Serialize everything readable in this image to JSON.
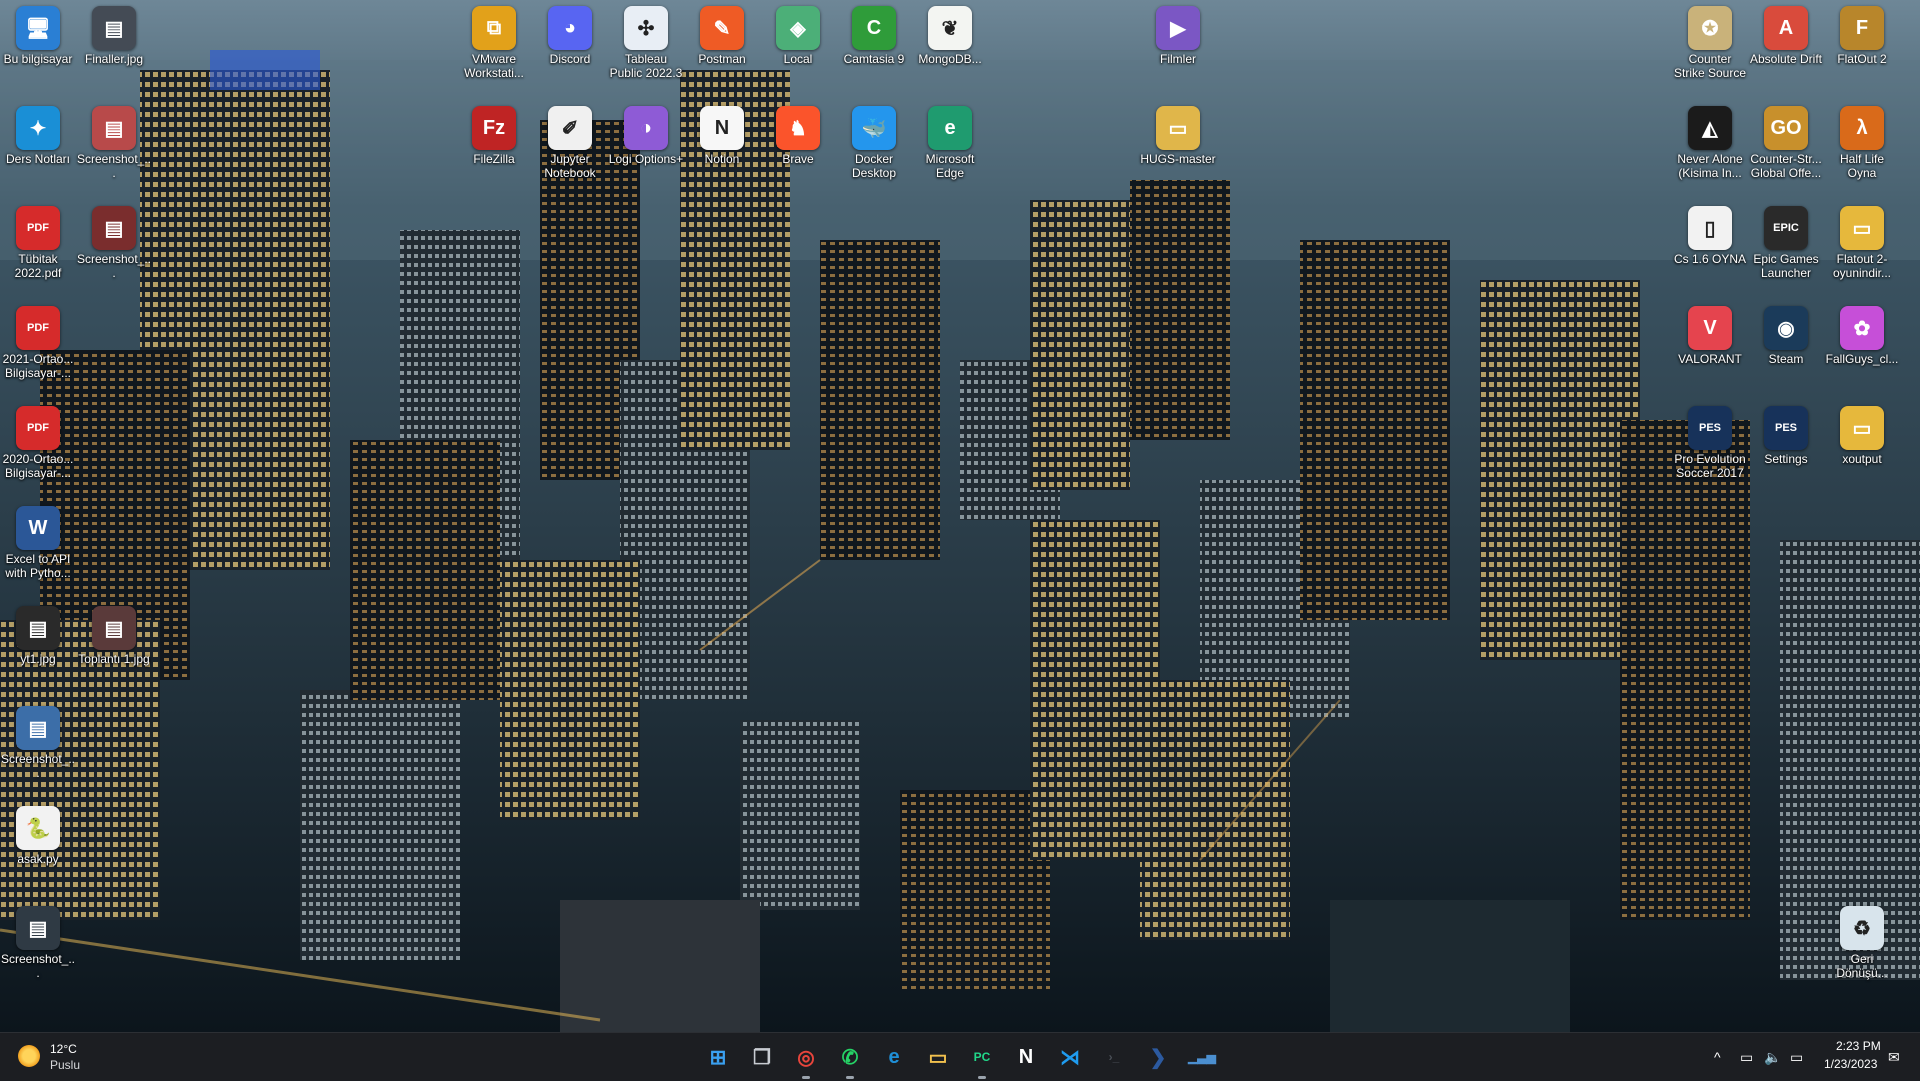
{
  "desktop": {
    "icons": [
      {
        "label": "Bu bilgisayar",
        "glyph": "🖥",
        "color": "#2a7fd4",
        "icon": "computer-icon"
      },
      {
        "label": "Finaller.jpg",
        "glyph": "▤",
        "color": "#444b55",
        "icon": "image-file-icon"
      },
      {
        "label": "VMware Workstati...",
        "glyph": "⧉",
        "color": "#e2a11a",
        "icon": "vmware-icon"
      },
      {
        "label": "Discord",
        "glyph": "◕",
        "color": "#5865f2",
        "icon": "discord-icon"
      },
      {
        "label": "Tableau Public 2022.3",
        "glyph": "✣",
        "color": "#e8eef5",
        "icon": "tableau-icon"
      },
      {
        "label": "Postman",
        "glyph": "✎",
        "color": "#ef5b25",
        "icon": "postman-icon"
      },
      {
        "label": "Local",
        "glyph": "◈",
        "color": "#4caf78",
        "icon": "local-icon"
      },
      {
        "label": "Camtasia 9",
        "glyph": "C",
        "color": "#2f9c3a",
        "icon": "camtasia-icon"
      },
      {
        "label": "MongoDB...",
        "glyph": "❦",
        "color": "#f3f5f2",
        "icon": "mongodb-icon"
      },
      {
        "label": "Filmler",
        "glyph": "▶",
        "color": "#7b57c4",
        "icon": "folder-videos-icon"
      },
      {
        "label": "Counter Strike Source",
        "glyph": "✪",
        "color": "#c9b27a",
        "icon": "css-icon"
      },
      {
        "label": "Absolute Drift",
        "glyph": "A",
        "color": "#d94b3c",
        "icon": "absolute-drift-icon"
      },
      {
        "label": "FlatOut 2",
        "glyph": "F",
        "color": "#b8862b",
        "icon": "flatout-icon"
      },
      {
        "label": "Ders Notları",
        "glyph": "✦",
        "color": "#1a8fd6",
        "icon": "accessibility-icon"
      },
      {
        "label": "Screenshot_...",
        "glyph": "▤",
        "color": "#b84a4a",
        "icon": "image-file-icon"
      },
      {
        "label": "FileZilla",
        "glyph": "Fz",
        "color": "#bf2424",
        "icon": "filezilla-icon"
      },
      {
        "label": "Jupyter Notebook",
        "glyph": "✐",
        "color": "#f0f0f0",
        "icon": "jupyter-icon"
      },
      {
        "label": "Logi Options+",
        "glyph": "◑",
        "color": "#8e5bd6",
        "icon": "logi-icon"
      },
      {
        "label": "Notion",
        "glyph": "N",
        "color": "#f7f7f7",
        "icon": "notion-icon"
      },
      {
        "label": "Brave",
        "glyph": "♞",
        "color": "#fb542b",
        "icon": "brave-icon"
      },
      {
        "label": "Docker Desktop",
        "glyph": "🐳",
        "color": "#2496ed",
        "icon": "docker-icon"
      },
      {
        "label": "Microsoft Edge",
        "glyph": "e",
        "color": "#1f9b6f",
        "icon": "edge-icon"
      },
      {
        "label": "HUGS-master",
        "glyph": "▭",
        "color": "#e0b64a",
        "icon": "folder-icon"
      },
      {
        "label": "Never Alone (Kisima In...",
        "glyph": "◭",
        "color": "#1b1b1b",
        "icon": "never-alone-icon"
      },
      {
        "label": "Counter-Str... Global Offe...",
        "glyph": "GO",
        "color": "#c8902c",
        "icon": "csgo-icon"
      },
      {
        "label": "Half Life Oyna",
        "glyph": "λ",
        "color": "#d96a1a",
        "icon": "half-life-icon"
      },
      {
        "label": "Tübitak 2022.pdf",
        "glyph": "PDF",
        "color": "#d62b2b",
        "icon": "pdf-icon"
      },
      {
        "label": "Screenshot_...",
        "glyph": "▤",
        "color": "#7a2d2d",
        "icon": "image-file-icon"
      },
      {
        "label": "Cs 1.6 OYNA",
        "glyph": "▯",
        "color": "#f2f2f2",
        "icon": "document-icon"
      },
      {
        "label": "Epic Games Launcher",
        "glyph": "EPIC",
        "color": "#2a2a2a",
        "icon": "epic-games-icon"
      },
      {
        "label": "Flatout 2-oyunindir...",
        "glyph": "▭",
        "color": "#e6b83c",
        "icon": "folder-icon"
      },
      {
        "label": "2021-Ortao... Bilgisayar-...",
        "glyph": "PDF",
        "color": "#d62b2b",
        "icon": "pdf-icon"
      },
      {
        "label": "VALORANT",
        "glyph": "V",
        "color": "#e5444e",
        "icon": "valorant-icon"
      },
      {
        "label": "Steam",
        "glyph": "◉",
        "color": "#1b3b5a",
        "icon": "steam-icon"
      },
      {
        "label": "FallGuys_cl...",
        "glyph": "✿",
        "color": "#c64fd8",
        "icon": "fallguys-icon"
      },
      {
        "label": "2020-Ortao... Bilgisayar-...",
        "glyph": "PDF",
        "color": "#d62b2b",
        "icon": "pdf-icon"
      },
      {
        "label": "Pro Evolution Soccer 2017",
        "glyph": "PES",
        "color": "#17325a",
        "icon": "pes-icon"
      },
      {
        "label": "Settings",
        "glyph": "PES",
        "color": "#17325a",
        "icon": "pes-settings-icon"
      },
      {
        "label": "xoutput",
        "glyph": "▭",
        "color": "#e6b83c",
        "icon": "folder-icon"
      },
      {
        "label": "Excel to API with Pytho...",
        "glyph": "W",
        "color": "#2b5797",
        "icon": "word-file-icon"
      },
      {
        "label": "yt1.jpg",
        "glyph": "▤",
        "color": "#2a2a2a",
        "icon": "image-file-icon"
      },
      {
        "label": "Toplantı 1.jpg",
        "glyph": "▤",
        "color": "#5a3a3a",
        "icon": "image-file-icon"
      },
      {
        "label": "Screenshot_...",
        "glyph": "▤",
        "color": "#3c6ea8",
        "icon": "image-file-icon"
      },
      {
        "label": "asak.py",
        "glyph": "🐍",
        "color": "#f2f2f2",
        "icon": "python-file-icon"
      },
      {
        "label": "Screenshot_...",
        "glyph": "▤",
        "color": "#2f3a44",
        "icon": "image-file-icon"
      },
      {
        "label": "Geri Dönüşü...",
        "glyph": "♻",
        "color": "#d8e4ec",
        "icon": "recycle-bin-icon"
      }
    ]
  },
  "taskbar": {
    "weather": {
      "temp": "12°C",
      "condition": "Puslu"
    },
    "apps": [
      {
        "name": "start",
        "glyph": "⊞",
        "color": "#3aa0f0",
        "icon": "windows-start-icon",
        "active": false
      },
      {
        "name": "task-view",
        "glyph": "❐",
        "color": "#c8ccd2",
        "icon": "task-view-icon",
        "active": false
      },
      {
        "name": "chrome",
        "glyph": "◎",
        "color": "#e8453c",
        "icon": "chrome-icon",
        "active": true
      },
      {
        "name": "whatsapp",
        "glyph": "✆",
        "color": "#25d366",
        "icon": "whatsapp-icon",
        "active": true
      },
      {
        "name": "edge",
        "glyph": "e",
        "color": "#1f8fd6",
        "icon": "edge-icon",
        "active": false
      },
      {
        "name": "file-explorer",
        "glyph": "▭",
        "color": "#f2c14e",
        "icon": "folder-icon",
        "active": false
      },
      {
        "name": "pycharm",
        "glyph": "PC",
        "color": "#21d789",
        "icon": "pycharm-icon",
        "active": true
      },
      {
        "name": "notion",
        "glyph": "N",
        "color": "#ffffff",
        "icon": "notion-icon",
        "active": false
      },
      {
        "name": "vscode",
        "glyph": "⋊",
        "color": "#1f9cf0",
        "icon": "vscode-icon",
        "active": false
      },
      {
        "name": "terminal",
        "glyph": "›_",
        "color": "#4a4f57",
        "icon": "terminal-icon",
        "active": false
      },
      {
        "name": "powershell",
        "glyph": "❯",
        "color": "#2c5aa0",
        "icon": "powershell-icon",
        "active": false
      },
      {
        "name": "resource-monitor",
        "glyph": "▁▃▅",
        "color": "#4b8fd0",
        "icon": "monitor-icon",
        "active": false
      }
    ],
    "tray": {
      "chevron": "^",
      "time": "2:23 PM",
      "date": "1/23/2023"
    }
  }
}
